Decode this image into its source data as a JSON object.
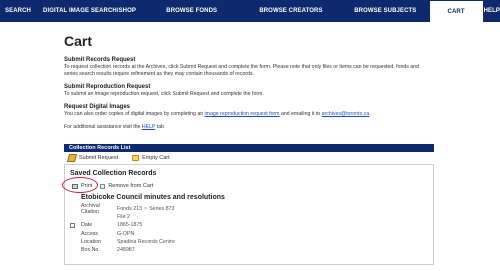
{
  "nav": {
    "search": "SEARCH",
    "digital": "DIGITAL IMAGE SEARCH/SHOP",
    "fonds": "BROWSE FONDS",
    "creators": "BROWSE CREATORS",
    "subjects": "BROWSE SUBJECTS",
    "cart": "CART",
    "help": "HELP"
  },
  "page": {
    "title": "Cart",
    "submit_title": "Submit Records Request",
    "submit_body": "To request collection records at the Archives, click Submit Request and complete the form. Please note that only files or items can be requested, fonds and series search results require refinement as they may contain thousands of records.",
    "repro_title": "Submit Reproduction Request",
    "repro_body": "To submit an image reproduction request, click Submit Request and complete the form.",
    "digital_title": "Request Digital Images",
    "digital_body_prefix": "You can also order copies of digital images by completing an ",
    "digital_link": "image reproduction request form",
    "digital_body_mid": " and emailing it to ",
    "digital_email": "archives@toronto.ca",
    "digital_body_suffix": ".",
    "help_prefix": "For additional assistance visit the ",
    "help_link": "HELP",
    "help_suffix": " tab"
  },
  "list": {
    "header": "Collection Records List",
    "submit": "Submit Request",
    "empty": "Empty Cart"
  },
  "saved": {
    "title": "Saved Collection Records",
    "print": "Print",
    "remove": "Remove from Cart",
    "record_title": "Etobicoke Council minutes and resolutions",
    "citation_label": "Archival Citation",
    "citation_fonds": "Fonds 213",
    "citation_series": "Series 873",
    "file_value": "File 2",
    "date_label": "Date",
    "date_value": "1865-1875",
    "access_label": "Access",
    "access_value": "G-OPN",
    "location_label": "Location",
    "location_value": "Spadina Records Centre",
    "box_label": "Box No.",
    "box_value": "248987"
  },
  "colors": {
    "nav_bg": "#0d2a6e",
    "link": "#1b4fc4",
    "highlight": "#d22020"
  }
}
